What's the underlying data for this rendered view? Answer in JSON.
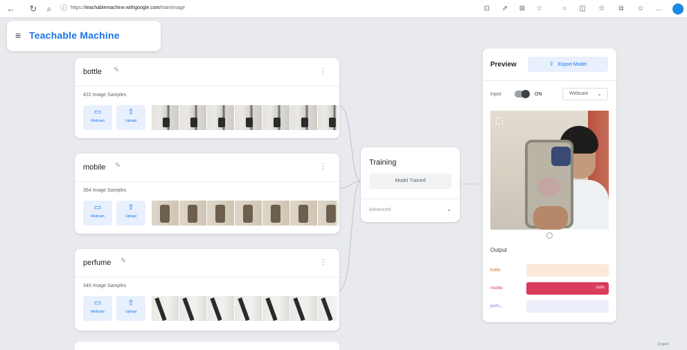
{
  "browser": {
    "url_host": "teachablemachine.withgoogle.com",
    "url_path": "/train/image"
  },
  "app": {
    "title": "Teachable Machine",
    "menu_icon": "hamburger-icon"
  },
  "classes": [
    {
      "name": "bottle",
      "samples_label": "422 Image Samples",
      "webcam_label": "Webcam",
      "upload_label": "Upload",
      "thumb_kind": "bottle",
      "thumb_count": 7
    },
    {
      "name": "mobile",
      "samples_label": "364 Image Samples",
      "webcam_label": "Webcam",
      "upload_label": "Upload",
      "thumb_kind": "mobile",
      "thumb_count": 7
    },
    {
      "name": "perfume",
      "samples_label": "349 Image Samples",
      "webcam_label": "Webcam",
      "upload_label": "Upload",
      "thumb_kind": "perfume",
      "thumb_count": 7
    }
  ],
  "training": {
    "title": "Training",
    "status_button": "Model Trained",
    "advanced_label": "Advanced"
  },
  "preview": {
    "title": "Preview",
    "export_label": "Export Model",
    "input_label": "Input",
    "input_state": "ON",
    "source_select": "Webcam",
    "output_title": "Output",
    "outputs": [
      {
        "label": "bottle",
        "value": 0,
        "label_color": "#e8710a",
        "track_color": "#fde8d7",
        "fill_color": "#e8710a",
        "pct": ""
      },
      {
        "label": "mobile",
        "value": 100,
        "label_color": "#d93c5c",
        "track_color": "#f9d6de",
        "fill_color": "#d93c5c",
        "pct": "100%"
      },
      {
        "label": "perfu...",
        "value": 0,
        "label_color": "#7a80c8",
        "track_color": "#eceefb",
        "fill_color": "#7a80c8",
        "pct": ""
      }
    ]
  },
  "status_bar": {
    "language": "English"
  },
  "colors": {
    "accent": "#1a73e8",
    "background": "#e8eaed"
  }
}
